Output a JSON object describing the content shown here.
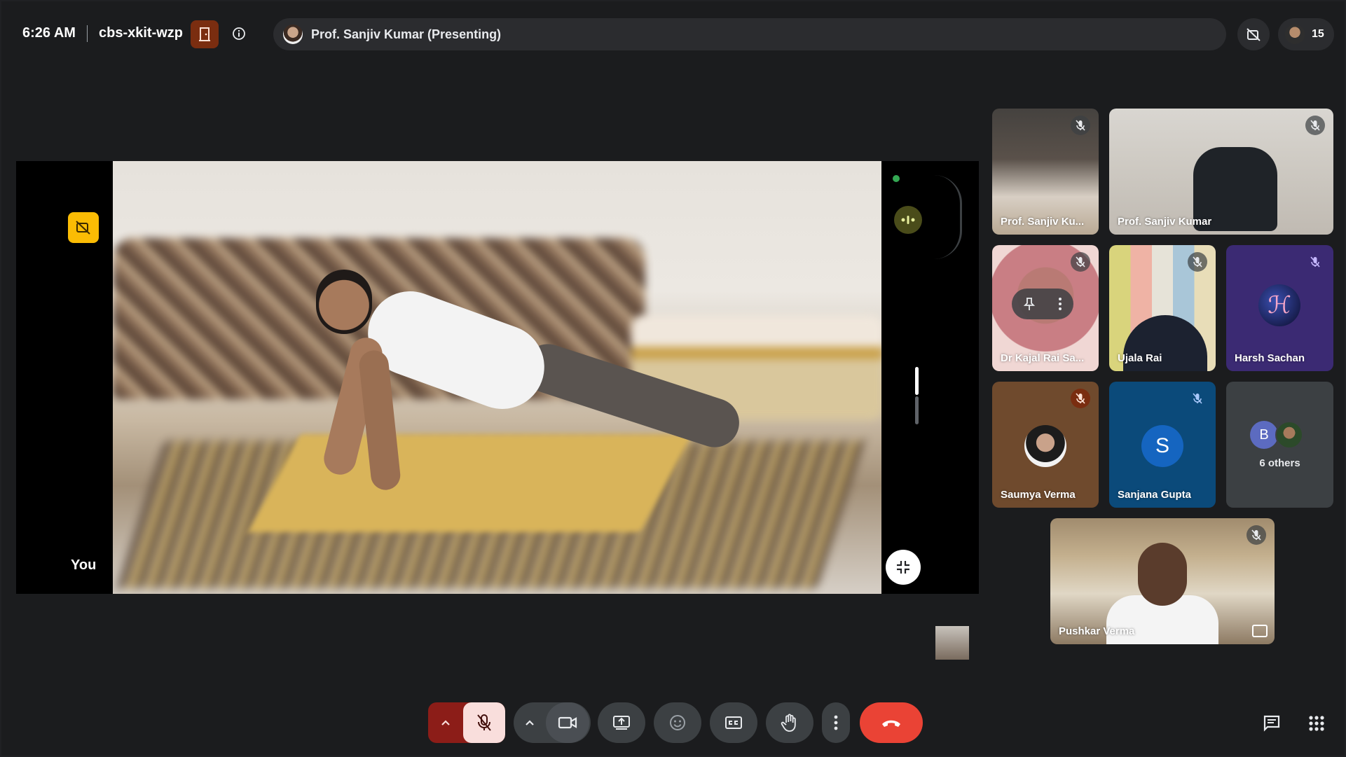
{
  "topbar": {
    "time": "6:26 AM",
    "meeting_code": "cbs-xkit-wzp",
    "presenting_label": "Prof. Sanjiv Kumar (Presenting)",
    "participant_count": "15"
  },
  "stage": {
    "self_label": "You"
  },
  "tiles": [
    {
      "name": "Prof. Sanjiv Ku...",
      "muted": true
    },
    {
      "name": "Prof. Sanjiv Kumar",
      "muted": true
    },
    {
      "name": "Dr Kajal Rai Sa...",
      "muted": true
    },
    {
      "name": "Ujala Rai",
      "muted": true
    },
    {
      "name": "Harsh Sachan",
      "muted": true
    },
    {
      "name": "Saumya Verma",
      "muted": true
    },
    {
      "name": "Sanjana Gupta",
      "muted": true,
      "initial": "S"
    },
    {
      "name": "6 others",
      "initial": "B"
    },
    {
      "name": "Pushkar Verma",
      "muted": true
    }
  ],
  "colors": {
    "end_call": "#ea4335",
    "mic_off_bg": "#f9dedc",
    "mic_off_accent": "#8c1d18",
    "camera_off_warning": "#fbbc04",
    "speaking_indicator": "#34a853"
  },
  "icons": {
    "door": "door-icon",
    "info": "info-icon",
    "camera_off": "camera-off-icon",
    "people": "people-icon",
    "mic_off": "mic-off-icon",
    "videocam": "videocam-icon",
    "present": "present-screen-icon",
    "emoji": "emoji-icon",
    "captions": "closed-captions-icon",
    "raise_hand": "raise-hand-icon",
    "more": "more-vert-icon",
    "end_call": "end-call-icon",
    "chat": "chat-icon",
    "apps": "apps-grid-icon"
  }
}
